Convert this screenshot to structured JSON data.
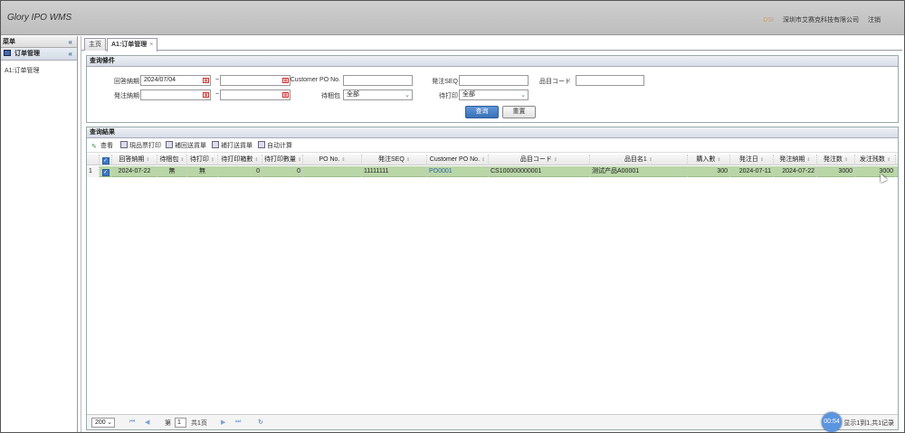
{
  "header": {
    "title": "Glory IPO WMS",
    "account": "DSI",
    "company": "深圳市艾赛克科技有限公司",
    "logout": "注销"
  },
  "sidebar": {
    "title": "菜单",
    "collapse": "«",
    "group": "订单管理",
    "group_toggle": "«",
    "items": [
      "A1:订单管理"
    ]
  },
  "tabs": [
    {
      "label": "主页"
    },
    {
      "label": "A1:订单管理",
      "close": "×"
    }
  ],
  "query": {
    "title": "查询條件",
    "fields": {
      "reply_date_label": "回答納期",
      "reply_date_from": "2024/07/04",
      "reply_date_to": "",
      "customer_po_label": "Customer PO No.",
      "customer_po": "",
      "order_seq_label": "発注SEQ",
      "order_seq": "",
      "item_code_label": "品目コード",
      "item_code": "",
      "order_date_label": "発注納期",
      "order_date_from": "",
      "order_date_to": "",
      "pending_label": "待梱包",
      "pending_value": "全部",
      "print_label": "待打印",
      "print_value": "全部",
      "tilde": "~"
    },
    "search_button": "查询",
    "reset_button": "重置"
  },
  "results": {
    "title": "查询結果",
    "toolbar": [
      "查看",
      "現品票打印",
      "補回送貨單",
      "補打送貨單",
      "自动计算"
    ],
    "columns": [
      "回答納期",
      "待梱包",
      "待打印",
      "待打印箱數",
      "待打印數量",
      "PO No.",
      "発注SEQ",
      "Customer PO No.",
      "品目コード",
      "品目名1",
      "購入數",
      "発注日",
      "発注納期",
      "発注数",
      "发注残数"
    ],
    "rows": [
      {
        "index": "1",
        "cells": [
          "2024-07-22",
          "無",
          "無",
          "0",
          "0",
          "",
          "11111111",
          "PO0001",
          "CS100000000001",
          "测试产品A00001",
          "300",
          "2024-07-11",
          "2024-07-22",
          "3000",
          "3000"
        ]
      }
    ]
  },
  "pager": {
    "page_size": "200",
    "page_prefix": "第",
    "page_value": "1",
    "page_suffix": "共1页",
    "summary": "显示1到1,共1记录"
  },
  "timer": "00:54",
  "colors": {
    "selected_row": "#b9d6a7",
    "primary_button": "#3a70b8"
  }
}
